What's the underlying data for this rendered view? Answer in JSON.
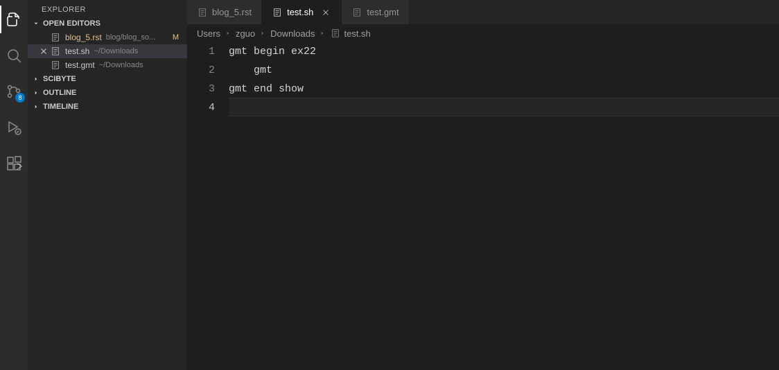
{
  "activityBar": {
    "badge": "8"
  },
  "sidebar": {
    "title": "EXPLORER",
    "openEditorsLabel": "OPEN EDITORS",
    "openEditors": [
      {
        "name": "blog_5.rst",
        "path": "blog/blog_so...",
        "modified": "M",
        "active": false
      },
      {
        "name": "test.sh",
        "path": "~/Downloads",
        "modified": "",
        "active": true
      },
      {
        "name": "test.gmt",
        "path": "~/Downloads",
        "modified": "",
        "active": false
      }
    ],
    "sections": [
      {
        "label": "SCIBYTE"
      },
      {
        "label": "OUTLINE"
      },
      {
        "label": "TIMELINE"
      }
    ]
  },
  "tabs": [
    {
      "name": "blog_5.rst",
      "active": false,
      "modified": true
    },
    {
      "name": "test.sh",
      "active": true,
      "modified": false
    },
    {
      "name": "test.gmt",
      "active": false,
      "modified": false
    }
  ],
  "breadcrumbs": [
    "Users",
    "zguo",
    "Downloads",
    "test.sh"
  ],
  "code": {
    "lines": [
      "gmt begin ex22",
      "    gmt",
      "gmt end show",
      ""
    ],
    "currentLine": 4
  }
}
